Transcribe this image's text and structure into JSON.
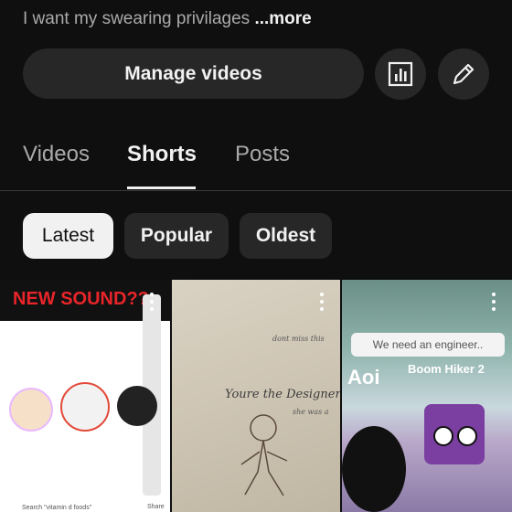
{
  "description": {
    "text": "I want my swearing privilages",
    "more_label": "...more"
  },
  "actions": {
    "manage_label": "Manage videos",
    "analytics_icon": "bar-chart-icon",
    "edit_icon": "pencil-icon"
  },
  "tabs": [
    {
      "label": "Videos",
      "active": false
    },
    {
      "label": "Shorts",
      "active": true
    },
    {
      "label": "Posts",
      "active": false
    }
  ],
  "filters": [
    {
      "label": "Latest",
      "active": true
    },
    {
      "label": "Popular",
      "active": false
    },
    {
      "label": "Oldest",
      "active": false
    }
  ],
  "shorts": [
    {
      "overlay_text": "NEW SOUND??",
      "caption": "Search \"vitamin d foods\"",
      "share_label": "Share"
    },
    {
      "overlay_text": "Youre the Designer",
      "overlay_text_small": "dont miss this",
      "overlay_text_small2": "she was a"
    },
    {
      "overlay_text": "Aoi",
      "bubble_text": "We need an engineer..",
      "name_tag": "Boom Hiker 2"
    }
  ]
}
